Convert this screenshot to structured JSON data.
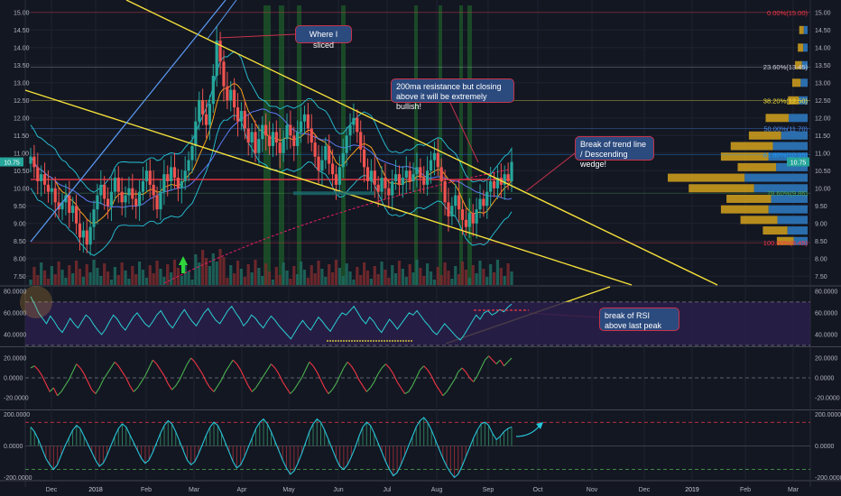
{
  "chart_data": [
    {
      "type": "candlestick",
      "panel": "price",
      "y_ticks": [
        "15.00",
        "14.50",
        "14.00",
        "13.50",
        "13.00",
        "12.50",
        "12.00",
        "11.50",
        "11.00",
        "10.50",
        "10.00",
        "9.50",
        "9.00",
        "8.50",
        "8.00",
        "7.50"
      ],
      "ylim": [
        7.25,
        15.2
      ],
      "last_price_label": "10.75",
      "candles_close": [
        10.9,
        10.6,
        10.2,
        10.4,
        10.1,
        9.9,
        10.0,
        9.6,
        9.4,
        9.6,
        9.8,
        9.3,
        9.5,
        9.0,
        8.6,
        8.8,
        8.4,
        8.9,
        9.4,
        9.8,
        10.1,
        9.7,
        9.5,
        9.9,
        10.3,
        9.9,
        9.6,
        9.8,
        10.0,
        9.7,
        9.5,
        9.9,
        10.2,
        10.5,
        10.1,
        9.8,
        9.4,
        9.9,
        10.4,
        10.2,
        10.6,
        10.3,
        10.0,
        10.2,
        10.5,
        10.8,
        11.2,
        11.9,
        12.5,
        12.1,
        11.8,
        12.4,
        13.2,
        14.2,
        13.6,
        12.9,
        12.5,
        12.8,
        12.3,
        11.9,
        12.2,
        11.7,
        11.3,
        11.6,
        11.0,
        11.4,
        11.8,
        11.5,
        11.2,
        11.6,
        11.3,
        11.0,
        11.4,
        11.8,
        11.5,
        11.2,
        11.6,
        11.9,
        12.1,
        11.7,
        11.3,
        10.9,
        10.5,
        10.8,
        11.2,
        10.7,
        10.4,
        10.1,
        10.6,
        11.0,
        11.5,
        11.8,
        12.0,
        11.6,
        11.1,
        10.6,
        10.2,
        10.5,
        10.1,
        9.9,
        10.3,
        10.0,
        9.8,
        10.2,
        10.4,
        10.1,
        10.3,
        10.5,
        10.2,
        10.4,
        10.6,
        10.3,
        10.1,
        10.5,
        10.8,
        11.0,
        10.6,
        10.2,
        9.6,
        9.2,
        9.5,
        9.8,
        9.4,
        9.1,
        8.9,
        9.3,
        9.0,
        9.4,
        9.7,
        9.5,
        9.9,
        10.2,
        10.0,
        10.3,
        10.1,
        10.4,
        10.2,
        10.75
      ],
      "annotations": [
        "Where I sliced",
        "200ma resistance but closing above it will be extremely bullish!",
        "Break of trend line / Descending wedge!"
      ],
      "fib_levels": [
        {
          "label": "0.00%(15.00)",
          "price": 15.0,
          "color": "#f23645"
        },
        {
          "label": "23.60%(13.45)",
          "price": 13.45,
          "color": "#d1d4dc"
        },
        {
          "label": "38.20%(12.50)",
          "price": 12.5,
          "color": "#f5e03a"
        },
        {
          "label": "50.00%(11.70)",
          "price": 11.7,
          "color": "#4c8ef5"
        },
        {
          "label": "61.80%(10.95)",
          "price": 10.95,
          "color": "#2196f3"
        },
        {
          "label": "78.60%(9.86)",
          "price": 9.86,
          "color": "#4caf50"
        },
        {
          "label": "100.00%(8.45)",
          "price": 8.45,
          "color": "#f23645"
        }
      ],
      "volume_profile": [
        {
          "price": 14.5,
          "value": 0.06
        },
        {
          "price": 14.0,
          "value": 0.07
        },
        {
          "price": 13.5,
          "value": 0.09
        },
        {
          "price": 13.0,
          "value": 0.11
        },
        {
          "price": 12.5,
          "value": 0.14
        },
        {
          "price": 12.0,
          "value": 0.3
        },
        {
          "price": 11.5,
          "value": 0.42
        },
        {
          "price": 11.2,
          "value": 0.55
        },
        {
          "price": 10.9,
          "value": 0.62
        },
        {
          "price": 10.6,
          "value": 0.5
        },
        {
          "price": 10.3,
          "value": 1.0
        },
        {
          "price": 10.0,
          "value": 0.85
        },
        {
          "price": 9.7,
          "value": 0.58
        },
        {
          "price": 9.4,
          "value": 0.62
        },
        {
          "price": 9.1,
          "value": 0.48
        },
        {
          "price": 8.8,
          "value": 0.32
        },
        {
          "price": 8.5,
          "value": 0.22
        }
      ]
    },
    {
      "type": "line",
      "panel": "rsi",
      "y_ticks": [
        "80.0000",
        "60.0000",
        "40.0000"
      ],
      "ylim": [
        30,
        84
      ],
      "bands": [
        70,
        30
      ],
      "annotation": "break of RSI above last peak",
      "values": [
        75,
        68,
        60,
        55,
        50,
        57,
        52,
        46,
        42,
        48,
        55,
        50,
        46,
        52,
        58,
        55,
        49,
        44,
        40,
        45,
        52,
        58,
        54,
        48,
        44,
        50,
        56,
        60,
        55,
        50,
        47,
        52,
        58,
        62,
        56,
        50,
        46,
        52,
        58,
        63,
        57,
        52,
        48,
        54,
        60,
        64,
        58,
        53,
        50,
        56,
        62,
        66,
        60,
        55,
        48,
        52,
        58,
        55,
        50,
        46,
        52,
        57,
        53,
        48,
        44,
        40,
        36,
        42,
        48,
        53,
        48,
        44,
        50,
        56,
        52,
        47,
        43,
        49,
        55,
        60,
        58,
        62,
        66,
        60,
        54,
        50,
        56,
        52,
        46,
        42,
        48,
        54,
        50,
        45,
        50,
        55,
        60,
        58,
        62,
        57,
        52,
        48,
        43,
        40,
        45,
        50,
        46,
        42,
        38,
        35,
        40,
        46,
        52,
        58,
        54,
        60,
        62,
        58,
        60,
        63,
        61,
        65,
        68
      ]
    },
    {
      "type": "line",
      "panel": "momentum",
      "y_ticks": [
        "20.0000",
        "0.0000",
        "-20.0000"
      ],
      "ylim": [
        -30,
        30
      ],
      "values": [
        10,
        12,
        8,
        2,
        -6,
        -14,
        -10,
        -18,
        -14,
        -8,
        -2,
        6,
        14,
        10,
        4,
        -4,
        -12,
        -16,
        -10,
        -2,
        4,
        10,
        16,
        12,
        6,
        0,
        -8,
        -14,
        -10,
        -4,
        2,
        10,
        18,
        14,
        8,
        2,
        -6,
        -12,
        -8,
        -2,
        6,
        14,
        20,
        16,
        10,
        4,
        -4,
        -10,
        -14,
        -8,
        -2,
        6,
        12,
        18,
        14,
        8,
        0,
        -8,
        -14,
        -10,
        -4,
        2,
        8,
        14,
        10,
        4,
        -4,
        -10,
        -16,
        -12,
        -6,
        0,
        8,
        16,
        12,
        6,
        -2,
        -10,
        -16,
        -12,
        -6,
        2,
        10,
        16,
        12,
        6,
        -2,
        -8,
        -14,
        -10,
        -4,
        4,
        10,
        14,
        10,
        4,
        -4,
        -10,
        -16,
        -14,
        -8,
        0,
        8,
        12,
        8,
        2,
        -6,
        -12,
        -18,
        -14,
        -8,
        -2,
        6,
        10,
        6,
        0,
        -4,
        2,
        10,
        18,
        22,
        18,
        14,
        18,
        12,
        16,
        20
      ]
    },
    {
      "type": "line",
      "panel": "oscillator",
      "y_ticks": [
        "200.0000",
        "0.0000",
        "-200.0000"
      ],
      "ylim": [
        -215,
        220
      ],
      "bands": [
        150,
        -150
      ],
      "values": [
        120,
        90,
        40,
        -20,
        -80,
        -120,
        -150,
        -120,
        -60,
        0,
        50,
        100,
        130,
        110,
        60,
        10,
        -40,
        -90,
        -130,
        -110,
        -60,
        0,
        60,
        110,
        140,
        120,
        70,
        20,
        -30,
        -80,
        -110,
        -90,
        -40,
        20,
        80,
        130,
        160,
        140,
        90,
        30,
        -30,
        -90,
        -120,
        -100,
        -50,
        10,
        70,
        120,
        150,
        130,
        80,
        20,
        -40,
        -100,
        -140,
        -120,
        -70,
        -10,
        50,
        110,
        150,
        170,
        140,
        90,
        30,
        -30,
        -90,
        -140,
        -180,
        -160,
        -110,
        -50,
        20,
        90,
        140,
        170,
        150,
        100,
        40,
        -20,
        -80,
        -130,
        -150,
        -120,
        -70,
        -10,
        60,
        120,
        150,
        130,
        80,
        20,
        -40,
        -100,
        -150,
        -190,
        -170,
        -120,
        -60,
        0,
        60,
        120,
        160,
        180,
        150,
        100,
        40,
        -20,
        -80,
        -130,
        -170,
        -200,
        -180,
        -130,
        -70,
        -10,
        50,
        100,
        140,
        150,
        130,
        80,
        40,
        60,
        90,
        110,
        120
      ]
    },
    {
      "type": "axis",
      "x_ticks": [
        "Dec",
        "2018",
        "Feb",
        "Mar",
        "Apr",
        "May",
        "Jun",
        "Jul",
        "Aug",
        "Sep",
        "Oct",
        "Nov",
        "Dec",
        "2019",
        "Feb",
        "Mar"
      ]
    }
  ],
  "annotations_text": {
    "sliced": "Where I sliced",
    "resistance": "200ma resistance but closing above it will be extremely bullish!",
    "wedge": "Break of trend line / Descending wedge!",
    "rsi": "break of RSI above last peak"
  },
  "colors": {
    "background": "#131722",
    "up": "#26a69a",
    "down": "#ef5350",
    "trendline": "#f5e03a",
    "rsi_line": "#29d0d3",
    "momentum_up": "#4caf50",
    "momentum_down": "#f23645",
    "osc_line": "#26c6da",
    "note_bg": "#2b4a7e",
    "note_border": "#c8334b"
  }
}
